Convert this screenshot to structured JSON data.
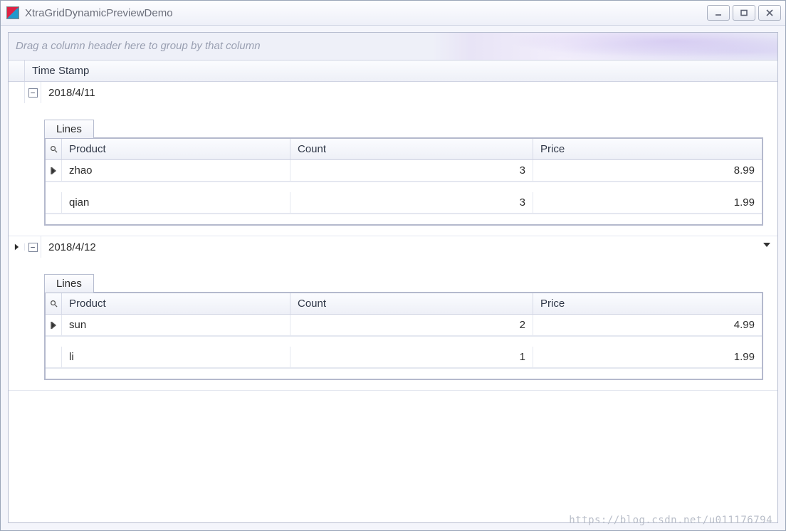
{
  "window": {
    "title": "XtraGridDynamicPreviewDemo"
  },
  "group_panel_hint": "Drag a column header here to group by that column",
  "master": {
    "columns": [
      "Time Stamp"
    ]
  },
  "detail": {
    "tab_label": "Lines",
    "columns": [
      "Product",
      "Count",
      "Price"
    ]
  },
  "records": [
    {
      "time_stamp": "2018/4/11",
      "expanded": true,
      "focused": false,
      "lines": [
        {
          "product": "zhao",
          "count": "3",
          "price": "8.99",
          "focused": true
        },
        {
          "product": "qian",
          "count": "3",
          "price": "1.99",
          "focused": false
        }
      ]
    },
    {
      "time_stamp": "2018/4/12",
      "expanded": true,
      "focused": true,
      "lines": [
        {
          "product": "sun",
          "count": "2",
          "price": "4.99",
          "focused": true
        },
        {
          "product": "li",
          "count": "1",
          "price": "1.99",
          "focused": false
        }
      ]
    }
  ],
  "watermark": "https://blog.csdn.net/u011176794"
}
